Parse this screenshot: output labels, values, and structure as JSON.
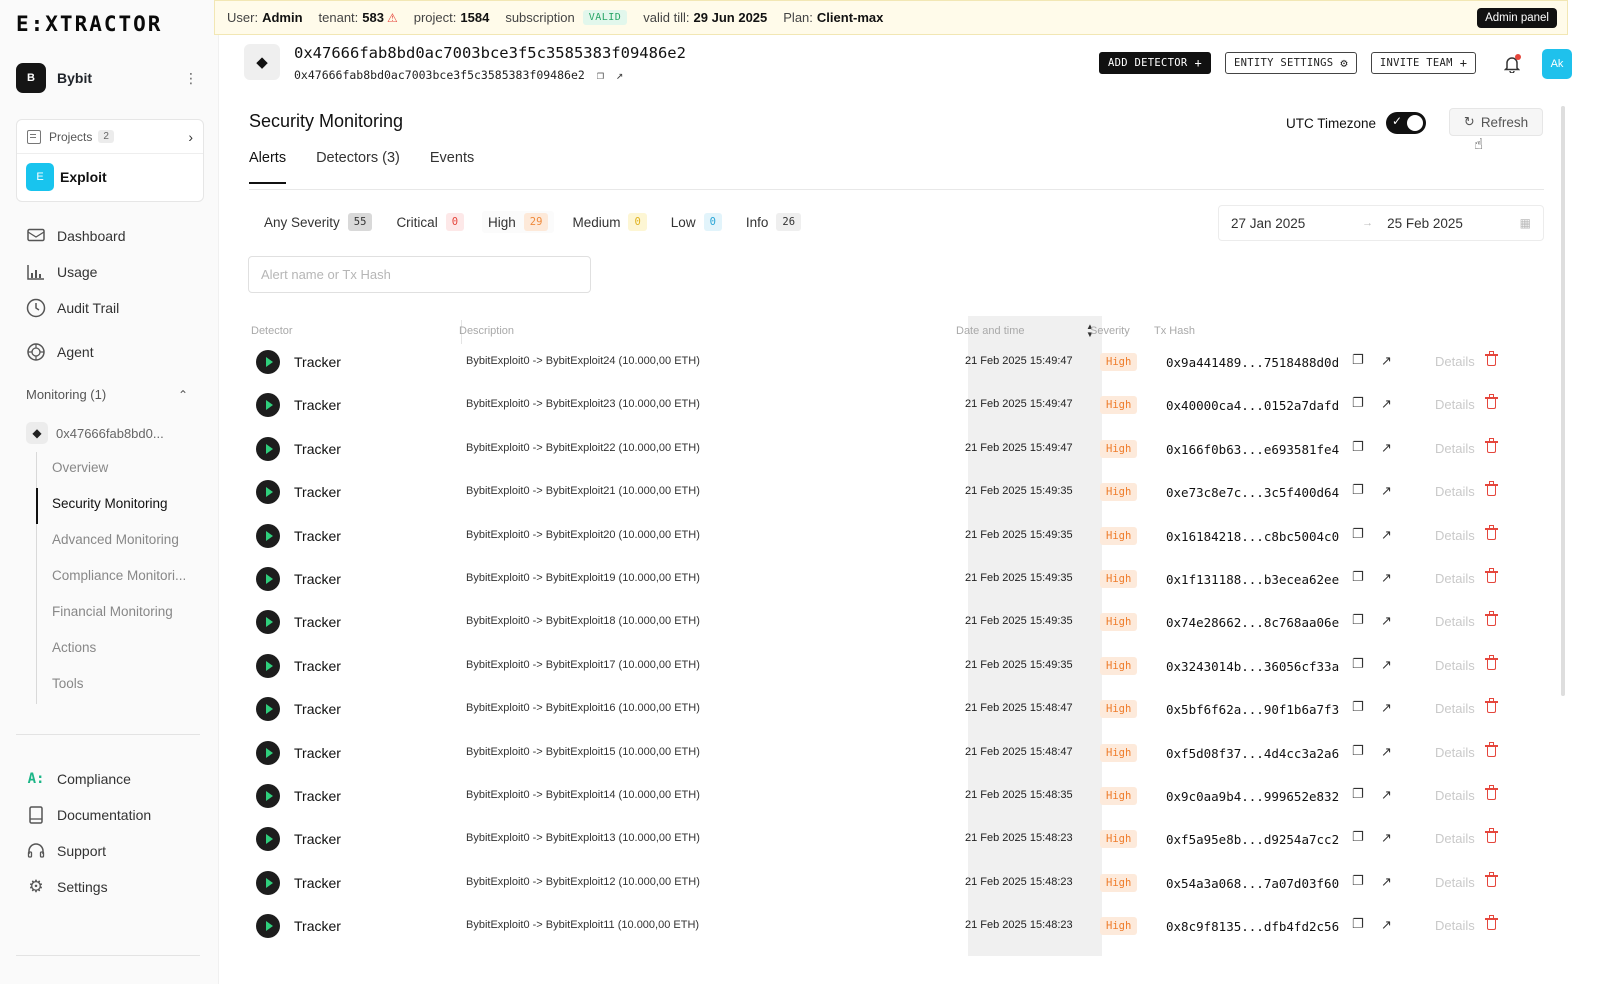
{
  "app": {
    "logo_text": "E:XTRACTOR"
  },
  "banner": {
    "user_label": "User:",
    "user": "Admin",
    "tenant_label": "tenant:",
    "tenant": "583",
    "project_label": "project:",
    "project": "1584",
    "subscription_label": "subscription",
    "subscription_status": "VALID",
    "valid_till_label": "valid till:",
    "valid_till": "29 Jun 2025",
    "plan_label": "Plan:",
    "plan": "Client-max",
    "admin_panel": "Admin panel"
  },
  "sidebar": {
    "org_initial": "B",
    "org_name": "Bybit",
    "more_glyph": "⋮",
    "projects_label": "Projects",
    "projects_count": "2",
    "project_initial": "E",
    "project_name": "Exploit",
    "nav": [
      {
        "label": "Dashboard",
        "icon": "dashboard-icon"
      },
      {
        "label": "Usage",
        "icon": "chart-icon"
      },
      {
        "label": "Audit Trail",
        "icon": "clock-icon"
      },
      {
        "label": "Agent",
        "icon": "agent-icon"
      }
    ],
    "monitoring_label": "Monitoring (1)",
    "entity_short": "0x47666fab8bd0...",
    "subnav": [
      "Overview",
      "Security Monitoring",
      "Advanced Monitoring",
      "Compliance Monitori...",
      "Financial Monitoring",
      "Actions",
      "Tools"
    ],
    "bottom_nav": [
      {
        "label": "Compliance",
        "icon": "compliance-icon"
      },
      {
        "label": "Documentation",
        "icon": "book-icon"
      },
      {
        "label": "Support",
        "icon": "headset-icon"
      },
      {
        "label": "Settings",
        "icon": "gear-icon"
      }
    ]
  },
  "entity": {
    "title": "0x47666fab8bd0ac7003bce3f5c3585383f09486e2",
    "address": "0x47666fab8bd0ac7003bce3f5c3585383f09486e2"
  },
  "actions": {
    "add_detector": "ADD DETECTOR",
    "add_detector_suffix": "+",
    "entity_settings": "ENTITY SETTINGS",
    "entity_settings_suffix": "⚙",
    "invite_team": "INVITE TEAM",
    "invite_team_suffix": "+",
    "user_initials": "Ak"
  },
  "page": {
    "title": "Security Monitoring",
    "utc_label": "UTC Timezone",
    "utc_enabled": true,
    "refresh": "Refresh",
    "tabs": [
      "Alerts",
      "Detectors (3)",
      "Events"
    ]
  },
  "filters": {
    "severities": [
      {
        "label": "Any Severity",
        "count": "55",
        "bg": "#d9d9d9",
        "fg": "#333333"
      },
      {
        "label": "Critical",
        "count": "0",
        "bg": "#fde8e8",
        "fg": "#e5463c"
      },
      {
        "label": "High",
        "count": "29",
        "bg": "#fde9d9",
        "fg": "#ef8a3c"
      },
      {
        "label": "Medium",
        "count": "0",
        "bg": "#fdf6d4",
        "fg": "#e0b321"
      },
      {
        "label": "Low",
        "count": "0",
        "bg": "#e2f4fb",
        "fg": "#2aa5d6"
      },
      {
        "label": "Info",
        "count": "26",
        "bg": "#efefef",
        "fg": "#333333"
      }
    ],
    "date_from": "27 Jan 2025",
    "date_to": "25 Feb 2025",
    "search_placeholder": "Alert name or Tx Hash"
  },
  "table": {
    "columns": {
      "detector": "Detector",
      "description": "Description",
      "datetime": "Date and time",
      "severity": "Severity",
      "txhash": "Tx Hash"
    },
    "details_label": "Details",
    "severity_colors": {
      "High": {
        "bg": "#fdeadb",
        "fg": "#ef7c2a"
      }
    },
    "rows": [
      {
        "detector": "Tracker",
        "description": "BybitExploit0 -> BybitExploit24 (10.000,00 ETH)",
        "datetime": "21 Feb 2025 15:49:47",
        "severity": "High",
        "tx": "0x9a441489...7518488d0d"
      },
      {
        "detector": "Tracker",
        "description": "BybitExploit0 -> BybitExploit23 (10.000,00 ETH)",
        "datetime": "21 Feb 2025 15:49:47",
        "severity": "High",
        "tx": "0x40000ca4...0152a7dafd"
      },
      {
        "detector": "Tracker",
        "description": "BybitExploit0 -> BybitExploit22 (10.000,00 ETH)",
        "datetime": "21 Feb 2025 15:49:47",
        "severity": "High",
        "tx": "0x166f0b63...e693581fe4"
      },
      {
        "detector": "Tracker",
        "description": "BybitExploit0 -> BybitExploit21 (10.000,00 ETH)",
        "datetime": "21 Feb 2025 15:49:35",
        "severity": "High",
        "tx": "0xe73c8e7c...3c5f400d64"
      },
      {
        "detector": "Tracker",
        "description": "BybitExploit0 -> BybitExploit20 (10.000,00 ETH)",
        "datetime": "21 Feb 2025 15:49:35",
        "severity": "High",
        "tx": "0x16184218...c8bc5004c0"
      },
      {
        "detector": "Tracker",
        "description": "BybitExploit0 -> BybitExploit19 (10.000,00 ETH)",
        "datetime": "21 Feb 2025 15:49:35",
        "severity": "High",
        "tx": "0x1f131188...b3ecea62ee"
      },
      {
        "detector": "Tracker",
        "description": "BybitExploit0 -> BybitExploit18 (10.000,00 ETH)",
        "datetime": "21 Feb 2025 15:49:35",
        "severity": "High",
        "tx": "0x74e28662...8c768aa06e"
      },
      {
        "detector": "Tracker",
        "description": "BybitExploit0 -> BybitExploit17 (10.000,00 ETH)",
        "datetime": "21 Feb 2025 15:49:35",
        "severity": "High",
        "tx": "0x3243014b...36056cf33a"
      },
      {
        "detector": "Tracker",
        "description": "BybitExploit0 -> BybitExploit16 (10.000,00 ETH)",
        "datetime": "21 Feb 2025 15:48:47",
        "severity": "High",
        "tx": "0x5bf6f62a...90f1b6a7f3"
      },
      {
        "detector": "Tracker",
        "description": "BybitExploit0 -> BybitExploit15 (10.000,00 ETH)",
        "datetime": "21 Feb 2025 15:48:47",
        "severity": "High",
        "tx": "0xf5d08f37...4d4cc3a2a6"
      },
      {
        "detector": "Tracker",
        "description": "BybitExploit0 -> BybitExploit14 (10.000,00 ETH)",
        "datetime": "21 Feb 2025 15:48:35",
        "severity": "High",
        "tx": "0x9c0aa9b4...999652e832"
      },
      {
        "detector": "Tracker",
        "description": "BybitExploit0 -> BybitExploit13 (10.000,00 ETH)",
        "datetime": "21 Feb 2025 15:48:23",
        "severity": "High",
        "tx": "0xf5a95e8b...d9254a7cc2"
      },
      {
        "detector": "Tracker",
        "description": "BybitExploit0 -> BybitExploit12 (10.000,00 ETH)",
        "datetime": "21 Feb 2025 15:48:23",
        "severity": "High",
        "tx": "0x54a3a068...7a07d03f60"
      },
      {
        "detector": "Tracker",
        "description": "BybitExploit0 -> BybitExploit11 (10.000,00 ETH)",
        "datetime": "21 Feb 2025 15:48:23",
        "severity": "High",
        "tx": "0x8c9f8135...dfb4fd2c56"
      }
    ]
  }
}
